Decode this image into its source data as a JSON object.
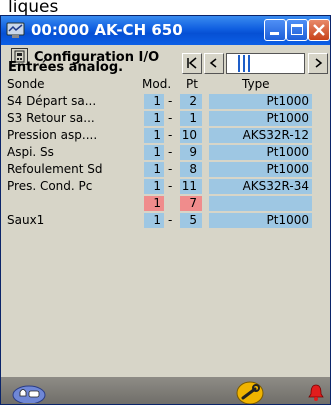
{
  "top_caption": "liques",
  "window": {
    "title": "00:000 AK-CH 650"
  },
  "header": {
    "title": "Configuration I/O"
  },
  "section": {
    "title": "Entrées analog."
  },
  "columns": {
    "sonde": "Sonde",
    "mod": "Mod.",
    "pt": "Pt",
    "type": "Type"
  },
  "rows": [
    {
      "name": "S4 Départ sa...",
      "mod": "1",
      "dash": "-",
      "pt": "2",
      "type": "Pt1000"
    },
    {
      "name": "S3 Retour sa...",
      "mod": "1",
      "dash": "-",
      "pt": "1",
      "type": "Pt1000"
    },
    {
      "name": "Pression asp....",
      "mod": "1",
      "dash": "-",
      "pt": "10",
      "type": "AKS32R-12"
    },
    {
      "name": "Aspi. Ss",
      "mod": "1",
      "dash": "-",
      "pt": "9",
      "type": "Pt1000"
    },
    {
      "name": "Refoulement Sd",
      "mod": "1",
      "dash": "-",
      "pt": "8",
      "type": "Pt1000"
    },
    {
      "name": "Pres. Cond. Pc",
      "mod": "1",
      "dash": "-",
      "pt": "11",
      "type": "AKS32R-34"
    },
    {
      "name": "",
      "mod": "1",
      "dash": "",
      "pt": "7",
      "type": ""
    },
    {
      "name": "Saux1",
      "mod": "1",
      "dash": "-",
      "pt": "5",
      "type": "Pt1000"
    }
  ],
  "colors": {
    "title_bar": "#0c5fe6",
    "cell_blue": "#9ec7e3",
    "cell_red": "#f08c8c",
    "window_bg": "#d7d5c8",
    "footer_bg": "#7a7873"
  },
  "icons": {
    "app": "computer-signal-icon",
    "header": "io-module-icon",
    "nav_first": "first-page-icon",
    "nav_prev": "previous-icon",
    "nav_next": "next-icon",
    "footer_left": "keys-icon",
    "footer_mid": "wrench-icon",
    "footer_right": "alarm-bell-icon"
  }
}
